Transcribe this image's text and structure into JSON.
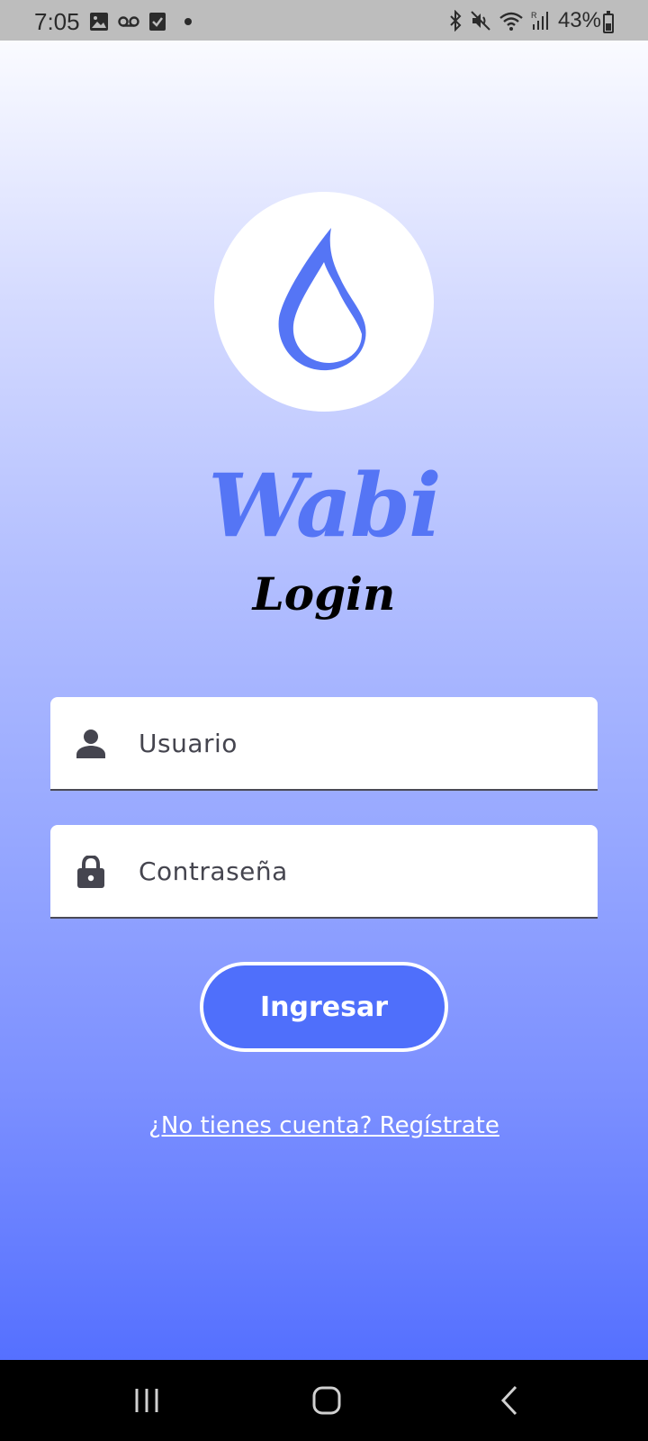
{
  "status_bar": {
    "time": "7:05",
    "battery_percent": "43%",
    "battery_level": 0.43,
    "left_icons": [
      "image-icon",
      "voicemail-icon",
      "checkbox-icon",
      "dot-icon"
    ],
    "right_icons": [
      "bluetooth-icon",
      "mute-icon",
      "wifi-icon",
      "signal-icon",
      "battery-icon"
    ]
  },
  "app": {
    "logo_icon": "water-drop-icon",
    "brand_name": "Wabi",
    "screen_title": "Login",
    "username_field": {
      "placeholder": "Usuario",
      "value": "",
      "icon": "person-icon"
    },
    "password_field": {
      "placeholder": "Contraseña",
      "value": "",
      "icon": "lock-icon"
    },
    "submit_label": "Ingresar",
    "register_link": "¿No tienes cuenta? Regístrate"
  },
  "colors": {
    "accent": "#4f6ffb",
    "brand_text": "#5575f5",
    "gradient_top": "#fafbff",
    "gradient_bottom": "#5570ff"
  },
  "nav_bar": {
    "buttons": [
      "recent-apps-icon",
      "home-icon",
      "back-icon"
    ]
  }
}
